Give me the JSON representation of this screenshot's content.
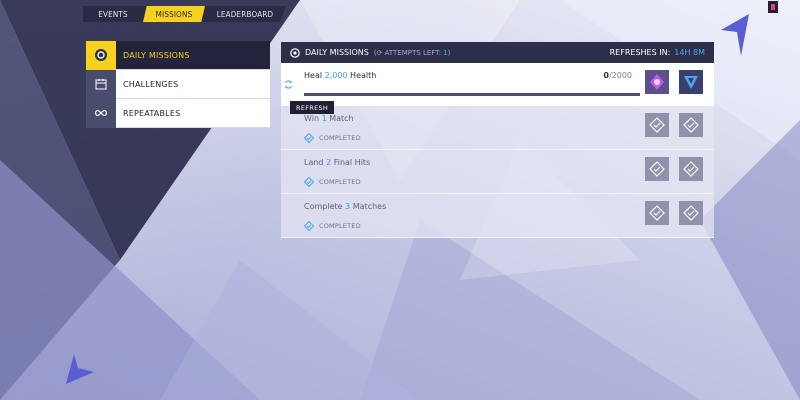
{
  "top_tabs": [
    {
      "label": "EVENTS"
    },
    {
      "label": "MISSIONS"
    },
    {
      "label": "LEADERBOARD"
    }
  ],
  "sidebar": {
    "items": [
      {
        "label": "DAILY MISSIONS",
        "icon": "badge-icon",
        "active": true
      },
      {
        "label": "CHALLENGES",
        "icon": "calendar-icon"
      },
      {
        "label": "REPEATABLES",
        "icon": "infinity-icon"
      }
    ]
  },
  "panel": {
    "title": "DAILY MISSIONS",
    "attempts_label": "ATTEMPTS LEFT:",
    "attempts_value": "1",
    "refresh_label": "REFRESHES IN:",
    "refresh_time": "14H 8M"
  },
  "missions": [
    {
      "prefix": "Heal ",
      "highlight": "2,000",
      "suffix": " Health",
      "current": "0",
      "total": "/2000",
      "progress": 0.0,
      "status": ""
    },
    {
      "prefix": "Win ",
      "highlight": "1",
      "suffix": " Match",
      "status": "COMPLETED"
    },
    {
      "prefix": "Land ",
      "highlight": "2",
      "suffix": " Final Hits",
      "status": "COMPLETED"
    },
    {
      "prefix": "Complete ",
      "highlight": "3",
      "suffix": " Matches",
      "status": "COMPLETED"
    }
  ],
  "tooltip": {
    "label": "REFRESH"
  },
  "colors": {
    "accent": "#f6d21e",
    "highlight": "#3a9be6",
    "dark": "#23243b"
  }
}
